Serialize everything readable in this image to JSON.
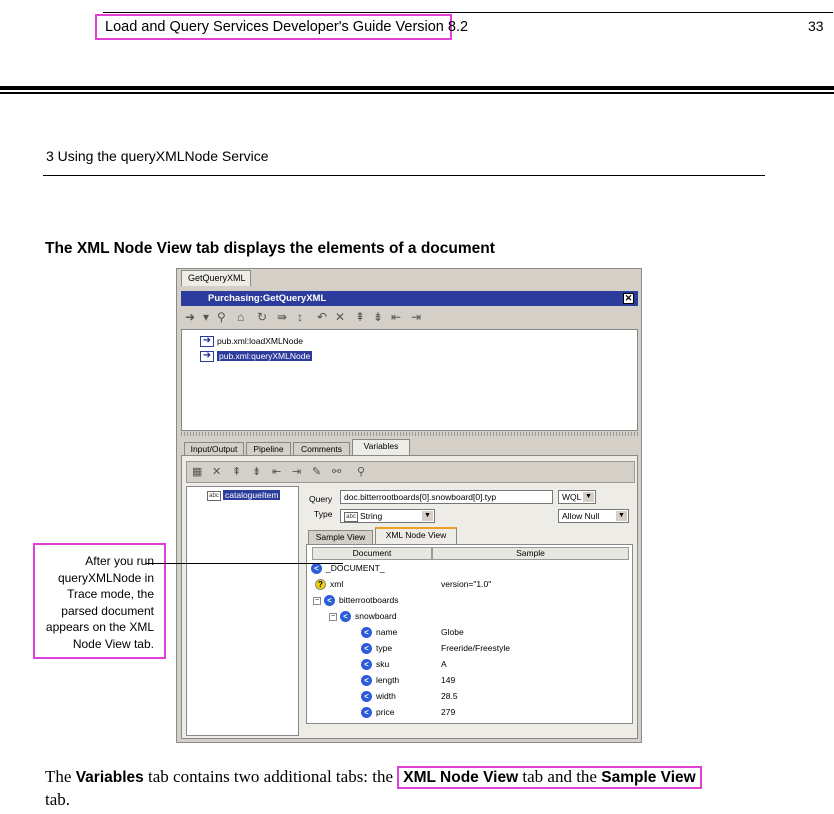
{
  "header": {
    "title": "Load and Query Services Developer's Guide Version 8.2",
    "page_number": "33"
  },
  "chapter": "3  Using the queryXMLNode Service",
  "figure_title": "The XML Node View tab displays the elements of a document",
  "screenshot": {
    "top_tab": "GetQueryXML",
    "window_title": "Purchasing:GetQueryXML",
    "close_glyph": "✕",
    "flow_steps": [
      "pub.xml:loadXMLNode",
      "pub.xml:queryXMLNode"
    ],
    "panel_tabs": [
      "Input/Output",
      "Pipeline",
      "Comments",
      "Variables"
    ],
    "variable_leaf": "catalogueItem",
    "query_label": "Query",
    "query_value": "doc.bitterrootboards[0].snowboard[0].typ",
    "query_lang": "WQL",
    "type_label": "Type",
    "type_value": "String",
    "allow_null": "Allow Null",
    "sub_tabs": [
      "Sample View",
      "XML Node View"
    ],
    "columns": [
      "Document",
      "Sample"
    ],
    "tree": [
      {
        "name": "_DOCUMENT_",
        "value": ""
      },
      {
        "name": "xml",
        "value": "version=\"1.0\""
      },
      {
        "name": "bitterrootboards",
        "value": ""
      },
      {
        "name": "snowboard",
        "value": ""
      },
      {
        "name": "name",
        "value": "Globe"
      },
      {
        "name": "type",
        "value": "Freeride/Freestyle"
      },
      {
        "name": "sku",
        "value": "A"
      },
      {
        "name": "length",
        "value": "149"
      },
      {
        "name": "width",
        "value": "28.5"
      },
      {
        "name": "price",
        "value": "279"
      }
    ]
  },
  "callout": "After you run queryXMLNode in Trace mode, the parsed document appears on the XML Node View tab.",
  "body": {
    "part1": "The ",
    "variables": "Variables",
    "part2": " tab contains two additional tabs: the ",
    "xml_node_view": "XML Node View",
    "part3": " tab and the ",
    "sample_view": "Sample View",
    "part4": " tab."
  }
}
